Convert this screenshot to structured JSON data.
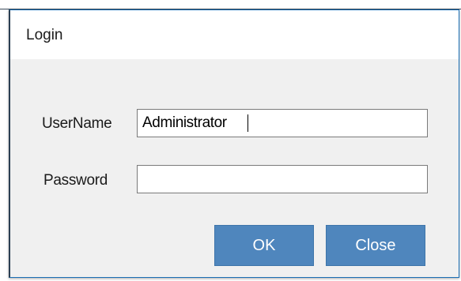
{
  "dialog": {
    "title": "Login"
  },
  "form": {
    "username_label": "UserName",
    "username_value": "Administrator",
    "password_label": "Password",
    "password_value": ""
  },
  "buttons": {
    "ok_label": "OK",
    "close_label": "Close"
  },
  "colors": {
    "button_bg": "#4f86bd",
    "button_text": "#ffffff",
    "dialog_bg": "#f0f0f0",
    "titlebar_bg": "#ffffff"
  }
}
